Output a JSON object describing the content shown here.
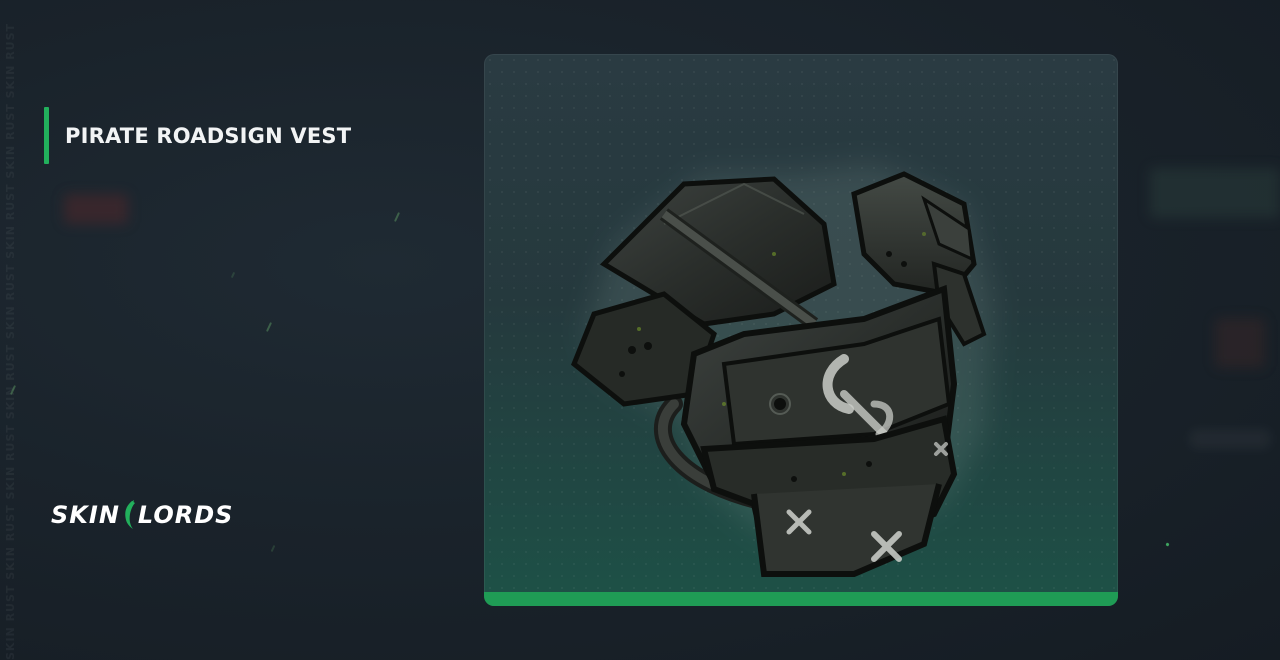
{
  "item": {
    "title": "PIRATE ROADSIGN VEST"
  },
  "brand": {
    "logo_left": "SKIN",
    "logo_right": "LORDS"
  },
  "watermark": {
    "text": "SKIN RUST SKIN RUST SKIN RUST SKIN RUST SKIN RUST SKIN RUST SKIN RUST SKIN RUST"
  },
  "colors": {
    "accent": "#22b05c",
    "card_bottom_bar": "#1f9c55",
    "background": "#1a232b"
  },
  "icons": {
    "logo_mark": "green-dragon-slash-icon",
    "item_image": "armored-vest-image"
  }
}
